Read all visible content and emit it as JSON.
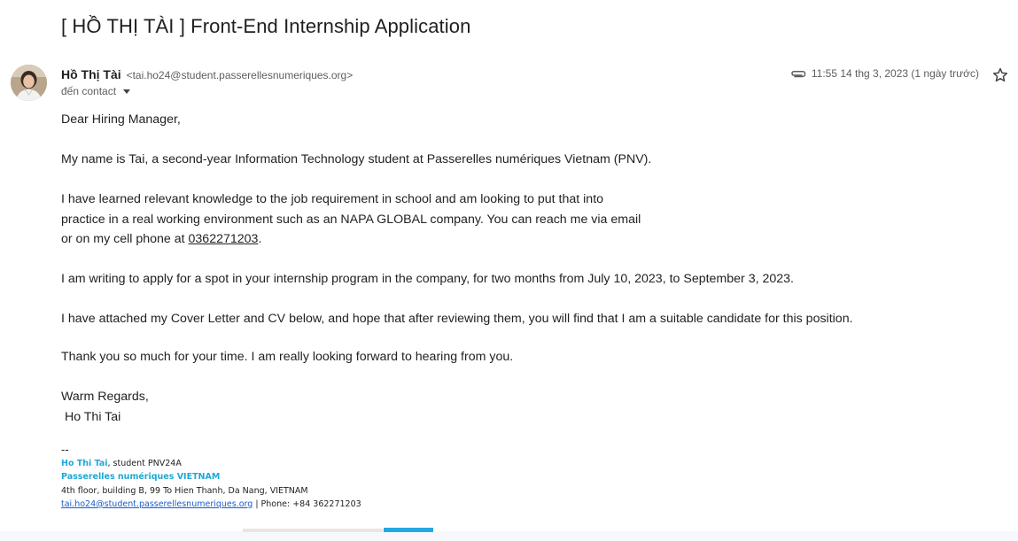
{
  "email": {
    "subject": "[ HỒ THỊ TÀI ] Front-End Internship Application",
    "sender_name": "Hồ Thị Tài",
    "sender_email": "<tai.ho24@student.passerellesnumeriques.org>",
    "recipient": "đến contact",
    "timestamp": "11:55 14 thg 3, 2023 (1 ngày trước)",
    "icons": {
      "attachment": "paperclip-icon",
      "star": "star-icon",
      "recipient_toggle": "chevron-down-icon",
      "avatar": "avatar-photo"
    }
  },
  "body": {
    "greeting": "Dear Hiring Manager,",
    "p1": "My name is Tai, a second-year Information Technology student at Passerelles numériques Vietnam (PNV).",
    "p2_line1": "I have learned relevant knowledge to the job requirement in school and am looking to put that into",
    "p2_line2": "practice in a real working environment such as an NAPA GLOBAL company. You can reach me via email",
    "p2_line3_prefix": "or on my cell phone at ",
    "phone": "0362271203",
    "p2_line3_suffix": ".",
    "p3": "I am writing to apply for a spot in your internship program in the company, for two months from July 10, 2023, to September 3, 2023.",
    "p4": "I have attached my Cover Letter and CV below, and hope that after reviewing them, you will find that I am a suitable candidate for this position.",
    "p5": "Thank you so much for your time. I am really looking forward to hearing from you.",
    "closing": "Warm Regards,",
    "closing_name": " Ho Thi Tai"
  },
  "signature": {
    "separator": "--",
    "name": "Ho Thi Tai",
    "role": ", student PNV24A",
    "org": "Passerelles numériques VIETNAM",
    "address": "4th floor, building B, 99 To Hien Thanh, Da Nang, VIETNAM",
    "email": "tai.ho24@student.passerellesnumeriques.org",
    "phone_text": " | Phone: +84 362271203"
  },
  "colors": {
    "signature_accent": "#1fa8d8",
    "link": "#1a5ccc",
    "muted": "#5e5e5e"
  }
}
